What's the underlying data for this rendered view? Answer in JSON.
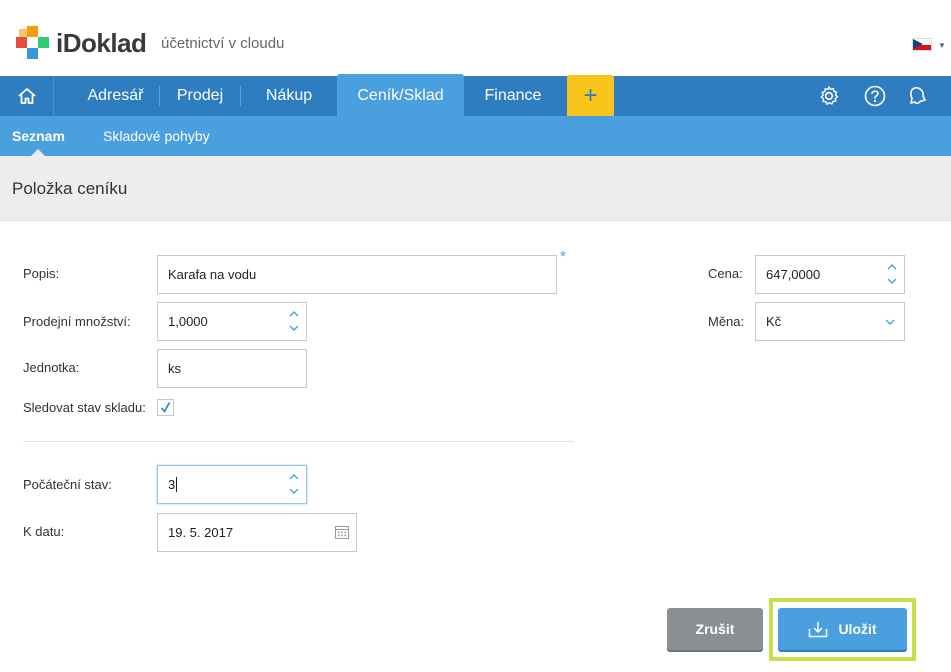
{
  "header": {
    "brand": "iDoklad",
    "tagline": "účetnictví v cloudu"
  },
  "nav": {
    "items": [
      {
        "label": "Adresář"
      },
      {
        "label": "Prodej"
      },
      {
        "label": "Nákup"
      },
      {
        "label": "Ceník/Sklad",
        "active": true
      },
      {
        "label": "Finance"
      }
    ],
    "plus_label": "+"
  },
  "subnav": {
    "items": [
      {
        "label": "Seznam",
        "active": true
      },
      {
        "label": "Skladové pohyby"
      }
    ]
  },
  "page": {
    "title": "Položka ceníku"
  },
  "form": {
    "popis_label": "Popis:",
    "popis_value": "Karafa na vodu",
    "required_mark": "*",
    "prodejni_label": "Prodejní množství:",
    "prodejni_value": "1,0000",
    "jednotka_label": "Jednotka:",
    "jednotka_value": "ks",
    "sledovat_label": "Sledovat stav skladu:",
    "sledovat_checked": true,
    "pocatecni_label": "Počáteční stav:",
    "pocatecni_value": "3",
    "kdatu_label": "K datu:",
    "kdatu_value": "19. 5. 2017",
    "cena_label": "Cena:",
    "cena_value": "647,0000",
    "mena_label": "Měna:",
    "mena_value": "Kč"
  },
  "actions": {
    "cancel_label": "Zrušit",
    "save_label": "Uložit"
  },
  "colors": {
    "nav_primary": "#2f7dc1",
    "nav_secondary": "#4a9fde",
    "accent_yellow": "#f9c51b",
    "highlight": "#c6e04a"
  }
}
